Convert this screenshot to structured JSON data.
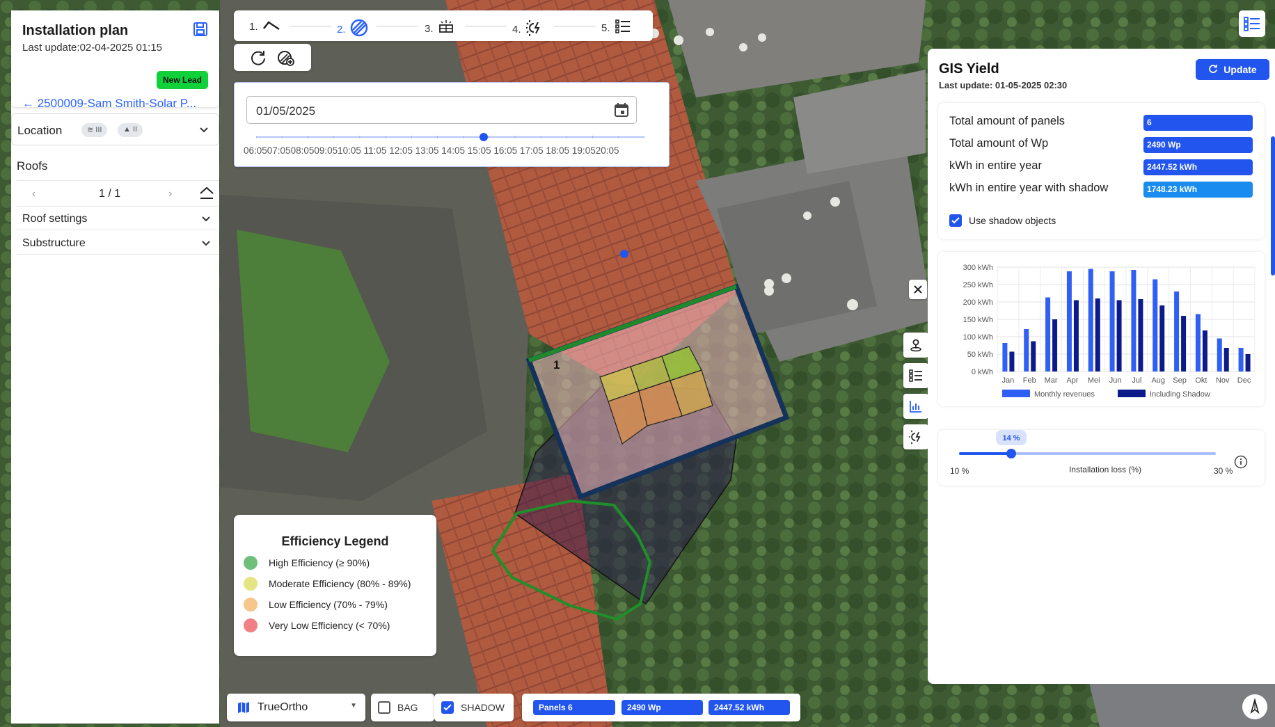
{
  "install": {
    "title": "Installation plan",
    "last_update": "Last update:02-04-2025 01:15",
    "lead_badge": "New Lead",
    "lead_link": "← 2500009-Sam Smith-Solar P..."
  },
  "location": {
    "label": "Location",
    "chip1": "III",
    "chip2": "II"
  },
  "roofs": {
    "heading": "Roofs",
    "pager": "1 / 1",
    "roof_settings": "Roof settings",
    "substructure": "Substructure"
  },
  "steps": [
    {
      "num": "1.",
      "icon": "roof-icon"
    },
    {
      "num": "2.",
      "icon": "shading-icon"
    },
    {
      "num": "3.",
      "icon": "solar-panel-icon"
    },
    {
      "num": "4.",
      "icon": "sun-energy-icon"
    },
    {
      "num": "5.",
      "icon": "list-icon"
    }
  ],
  "date": {
    "value": "01/05/2025",
    "times": "06:0507:0508:0509:0510:05  11:05  12:05  13:05  14:05  15:05  16:05  17:05  18:05  19:0520:05",
    "slider_fraction": 0.586
  },
  "roof_number": "1",
  "legend": {
    "title": "Efficiency Legend",
    "items": [
      {
        "label": "High Efficiency (≥ 90%)",
        "color": "#6fbf7a"
      },
      {
        "label": "Moderate Efficiency (80% - 89%)",
        "color": "#e6e585"
      },
      {
        "label": "Low Efficiency (70% - 79%)",
        "color": "#f7c68b"
      },
      {
        "label": "Very Low Efficiency (< 70%)",
        "color": "#f07f86"
      }
    ]
  },
  "bottom": {
    "map_type": "TrueOrtho",
    "bag": "BAG",
    "shadow": "SHADOW",
    "panels": "Panels 6",
    "wp": "2490 Wp",
    "kwh": "2447.52 kWh"
  },
  "gis": {
    "title": "GIS Yield",
    "last_update": "Last update: 01-05-2025 02:30",
    "update_btn": "Update",
    "stats": [
      {
        "label": "Total amount of panels",
        "value": "6"
      },
      {
        "label": "Total amount of Wp",
        "value": "2490 Wp"
      },
      {
        "label": "kWh in entire year",
        "value": "2447.52 kWh"
      },
      {
        "label": "kWh in entire year with shadow",
        "value": "1748.23 kWh"
      }
    ],
    "use_shadow": "Use shadow objects",
    "loss": {
      "value_label": "14 %",
      "value": 14,
      "min_label": "10 %",
      "max_label": "30 %",
      "title": "Installation loss (%)"
    }
  },
  "chart_data": {
    "type": "bar",
    "categories": [
      "Jan",
      "Feb",
      "Mar",
      "Apr",
      "Mei",
      "Jun",
      "Jul",
      "Aug",
      "Sep",
      "Okt",
      "Nov",
      "Dec"
    ],
    "series": [
      {
        "name": "Monthly revenues",
        "color": "#2f5ff5",
        "values": [
          82,
          122,
          213,
          288,
          295,
          288,
          292,
          265,
          230,
          165,
          95,
          68
        ]
      },
      {
        "name": "Including Shadow",
        "color": "#0d1a8c",
        "values": [
          57,
          87,
          150,
          205,
          210,
          205,
          208,
          190,
          160,
          118,
          68,
          50
        ]
      }
    ],
    "yticks": [
      "0 kWh",
      "50 kWh",
      "100 kWh",
      "150 kWh",
      "200 kWh",
      "250 kWh",
      "300 kWh"
    ],
    "ylim": [
      0,
      300
    ],
    "legend_position": "bottom"
  }
}
